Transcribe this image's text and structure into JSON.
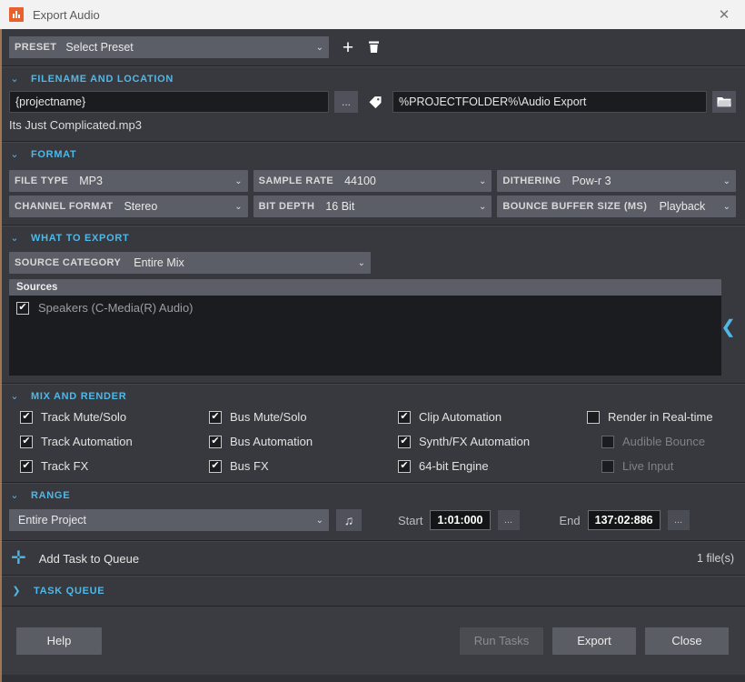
{
  "window": {
    "title": "Export Audio",
    "app_icon": "bar-chart-icon",
    "close_label": "✕",
    "accent_blue": "#4fb8e8",
    "accent_orange": "#e8602c"
  },
  "preset": {
    "label": "PRESET",
    "value": "Select Preset",
    "add_label": "+",
    "delete_label": "delete-icon"
  },
  "filename_section": {
    "title": "FILENAME AND LOCATION",
    "name_value": "{projectname}",
    "browse_label": "...",
    "tag_icon": "tag-icon",
    "path_value": "%PROJECTFOLDER%\\Audio Export",
    "folder_icon": "folder-icon",
    "resolved_name": "Its Just Complicated.mp3"
  },
  "format_section": {
    "title": "FORMAT",
    "fields": [
      {
        "label": "FILE TYPE",
        "value": "MP3"
      },
      {
        "label": "CHANNEL FORMAT",
        "value": "Stereo"
      },
      {
        "label": "SAMPLE RATE",
        "value": "44100"
      },
      {
        "label": "BIT DEPTH",
        "value": "16 Bit"
      },
      {
        "label": "DITHERING",
        "value": "Pow-r 3"
      },
      {
        "label": "BOUNCE BUFFER SIZE (MS)",
        "value": "Playback"
      }
    ]
  },
  "what_to_export": {
    "title": "WHAT TO EXPORT",
    "source_category_label": "SOURCE CATEGORY",
    "source_category_value": "Entire Mix",
    "list_header": "Sources",
    "items": [
      {
        "label": "Speakers (C-Media(R) Audio)",
        "checked": true
      }
    ],
    "collapse_icon": "chevron-left-icon"
  },
  "mix_and_render": {
    "title": "MIX AND RENDER",
    "options": [
      {
        "label": "Track Mute/Solo",
        "checked": true,
        "disabled": false
      },
      {
        "label": "Bus Mute/Solo",
        "checked": true,
        "disabled": false
      },
      {
        "label": "Clip Automation",
        "checked": true,
        "disabled": false
      },
      {
        "label": "Render in Real-time",
        "checked": false,
        "disabled": false
      },
      {
        "label": "Track Automation",
        "checked": true,
        "disabled": false
      },
      {
        "label": "Bus Automation",
        "checked": true,
        "disabled": false
      },
      {
        "label": "Synth/FX Automation",
        "checked": true,
        "disabled": false
      },
      {
        "label": "Audible Bounce",
        "checked": false,
        "disabled": true
      },
      {
        "label": "Track FX",
        "checked": true,
        "disabled": false
      },
      {
        "label": "Bus FX",
        "checked": true,
        "disabled": false
      },
      {
        "label": "64-bit Engine",
        "checked": true,
        "disabled": false
      },
      {
        "label": "Live Input",
        "checked": false,
        "disabled": true
      }
    ]
  },
  "range_section": {
    "title": "RANGE",
    "range_value": "Entire Project",
    "note_icon": "music-note-icon",
    "start_label": "Start",
    "start_value": "1:01:000",
    "start_more": "...",
    "end_label": "End",
    "end_value": "137:02:886",
    "end_more": "..."
  },
  "add_task": {
    "icon": "plus-icon",
    "label": "Add Task to Queue",
    "count": "1 file(s)"
  },
  "task_queue": {
    "title": "TASK QUEUE",
    "expand_icon": "chevron-right-icon"
  },
  "footer": {
    "help": "Help",
    "run_tasks": "Run Tasks",
    "run_tasks_disabled": true,
    "export": "Export",
    "close": "Close"
  }
}
